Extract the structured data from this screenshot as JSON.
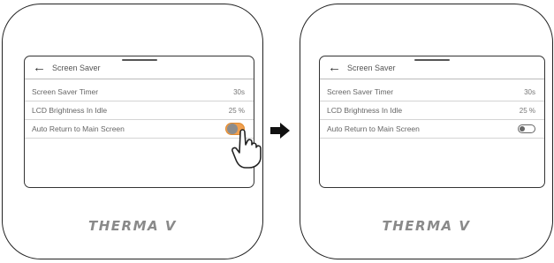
{
  "screens": [
    {
      "header": {
        "back_icon": "←",
        "title": "Screen Saver"
      },
      "rows": [
        {
          "label": "Screen Saver Timer",
          "value": "30s"
        },
        {
          "label": "LCD Brightness In Idle",
          "value": "25 %"
        },
        {
          "label": "Auto Return to Main Screen",
          "toggle": "on-pressed"
        }
      ],
      "logo": "THERMA V"
    },
    {
      "header": {
        "back_icon": "←",
        "title": "Screen Saver"
      },
      "rows": [
        {
          "label": "Screen Saver Timer",
          "value": "30s"
        },
        {
          "label": "LCD Brightness In Idle",
          "value": "25 %"
        },
        {
          "label": "Auto Return to Main Screen",
          "toggle": "off"
        }
      ],
      "logo": "THERMA V"
    }
  ],
  "colors": {
    "toggle_pressed": "#f0a050",
    "outline": "#222222"
  },
  "icons": {
    "transition": "right-arrow-icon",
    "pointer": "hand-pointer-icon"
  }
}
